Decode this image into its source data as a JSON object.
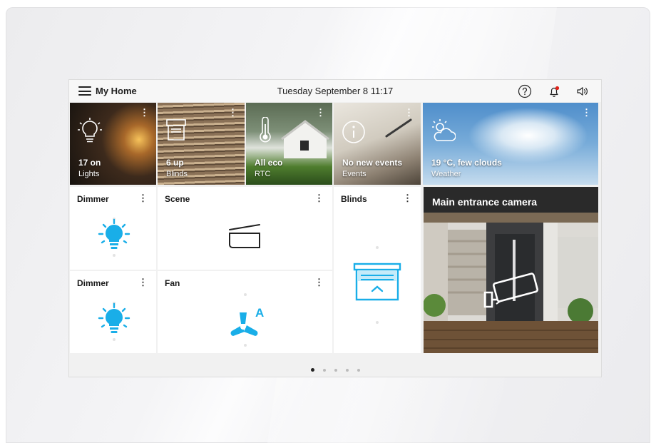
{
  "header": {
    "title": "My Home",
    "datetime": "Tuesday September 8 11:17",
    "notification_dot_color": "#e0231a"
  },
  "tiles": [
    {
      "value": "17 on",
      "label": "Lights",
      "icon": "lightbulb-icon"
    },
    {
      "value": "6 up",
      "label": "Blinds",
      "icon": "blinds-icon"
    },
    {
      "value": "All eco",
      "label": "RTC",
      "icon": "thermometer-icon"
    },
    {
      "value": "No new events",
      "label": "Events",
      "icon": "info-icon"
    },
    {
      "value": "19 °C, few clouds",
      "label": "Weather",
      "icon": "partly-cloudy-icon"
    }
  ],
  "cards": {
    "dimmer1": {
      "title": "Dimmer",
      "icon": "lightbulb-icon"
    },
    "scene": {
      "title": "Scene",
      "icon": "scene-icon"
    },
    "blinds": {
      "title": "Blinds",
      "icon": "blinds-icon"
    },
    "dimmer2": {
      "title": "Dimmer",
      "icon": "lightbulb-icon"
    },
    "fan": {
      "title": "Fan",
      "icon": "fan-auto-icon",
      "mode_letter": "A"
    }
  },
  "camera": {
    "title": "Main entrance camera"
  },
  "pagination": {
    "pages": 5,
    "active": 1
  },
  "colors": {
    "accent": "#19aee8",
    "text": "#1b1b1b"
  }
}
